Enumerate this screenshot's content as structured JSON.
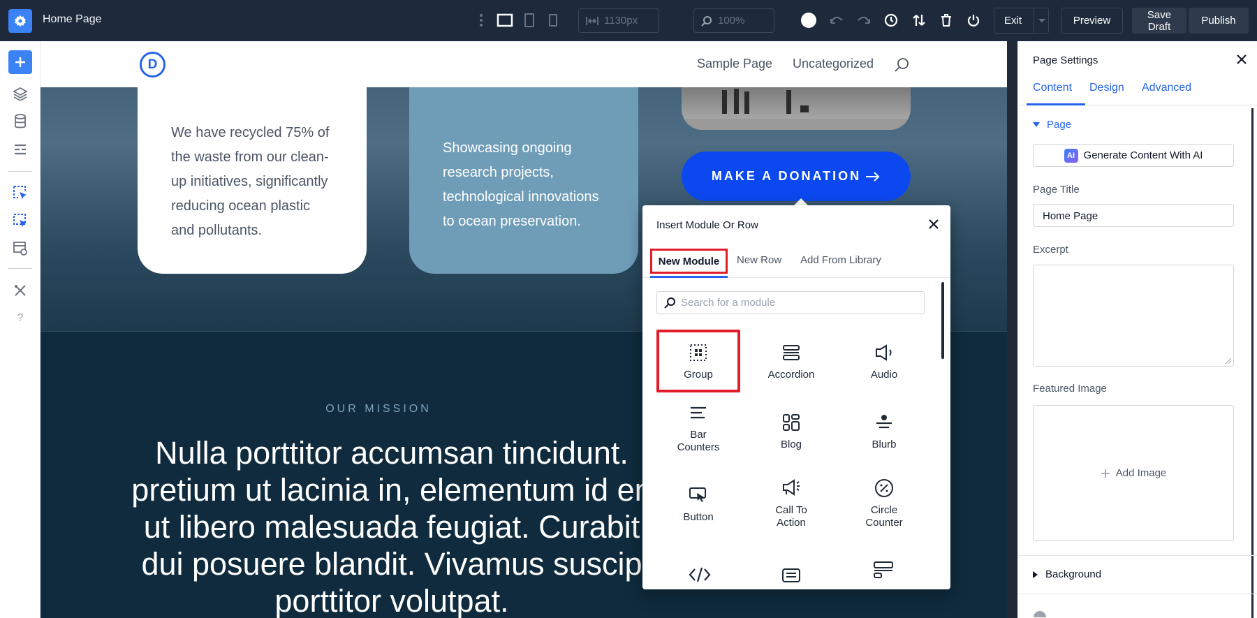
{
  "app": {
    "page_name": "Home Page"
  },
  "toolbar": {
    "width_value": "1130px",
    "zoom_value": "100%",
    "exit_label": "Exit",
    "preview_label": "Preview",
    "save_draft_label": "Save Draft",
    "publish_label": "Publish"
  },
  "site": {
    "logo_letter": "D",
    "nav": [
      "Sample Page",
      "Uncategorized"
    ],
    "card_white_text": "We have recycled 75% of the waste from our clean-up initiatives, significantly reducing ocean plastic and pollutants.",
    "card_blue_text": "Showcasing ongoing research projects, technological innovations to ocean preservation.",
    "donate_label": "MAKE A DONATION",
    "mission_label": "OUR MISSION",
    "mission_text": "Nulla porttitor accumsan tincidunt. pretium ut lacinia in, elementum id en ut libero malesuada feugiat. Curabit dui posuere blandit. Vivamus suscip porttitor volutpat."
  },
  "modal": {
    "title": "Insert Module Or Row",
    "tabs": [
      "New Module",
      "New Row",
      "Add From Library"
    ],
    "search_placeholder": "Search for a module",
    "modules": [
      "Group",
      "Accordion",
      "Audio",
      "Bar Counters",
      "Blog",
      "Blurb",
      "Button",
      "Call To Action",
      "Circle Counter"
    ]
  },
  "panel": {
    "title": "Page Settings",
    "tabs": [
      "Content",
      "Design",
      "Advanced"
    ],
    "section_page": "Page",
    "ai_button": "Generate Content With AI",
    "ai_badge": "AI",
    "page_title_label": "Page Title",
    "page_title_value": "Home Page",
    "excerpt_label": "Excerpt",
    "featured_image_label": "Featured Image",
    "add_image_label": "Add Image",
    "section_background": "Background"
  },
  "colors": {
    "accent": "#2563eb",
    "highlight": "#e11d2a",
    "donate": "#0b48f0",
    "topbar": "#1e2a3b"
  }
}
